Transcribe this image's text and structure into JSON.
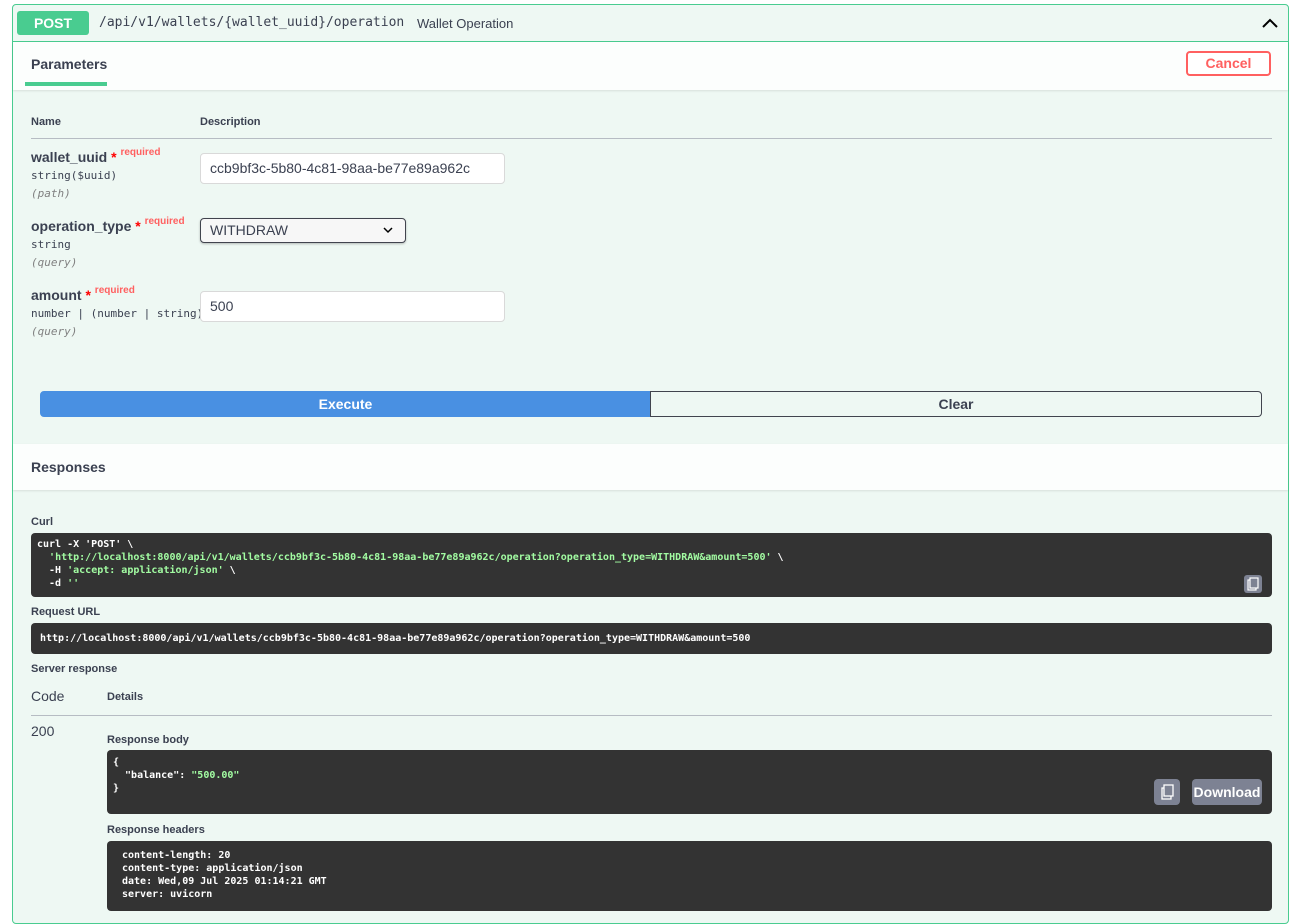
{
  "operation": {
    "method": "POST",
    "path": "/api/v1/wallets/{wallet_uuid}/operation",
    "summary": "Wallet Operation"
  },
  "parameters_tab": "Parameters",
  "cancel_label": "Cancel",
  "table": {
    "name_header": "Name",
    "description_header": "Description"
  },
  "params": [
    {
      "name": "wallet_uuid",
      "star": "*",
      "required": "required",
      "type": "string($uuid)",
      "in": "(path)",
      "value": "ccb9bf3c-5b80-4c81-98aa-be77e89a962c"
    },
    {
      "name": "operation_type",
      "star": "*",
      "required": "required",
      "type": "string",
      "in": "(query)",
      "value": "WITHDRAW"
    },
    {
      "name": "amount",
      "star": "*",
      "required": "required",
      "type": "number | (number | string)",
      "in": "(query)",
      "value": "500"
    }
  ],
  "execute_label": "Execute",
  "clear_label": "Clear",
  "responses_title": "Responses",
  "curl": {
    "label": "Curl",
    "line1": "curl -X 'POST' \\",
    "line2_url": "'http://localhost:8000/api/v1/wallets/ccb9bf3c-5b80-4c81-98aa-be77e89a962c/operation?operation_type=WITHDRAW&amount=500'",
    "line2_tail": " \\",
    "line3_flag": "  -H ",
    "line3_val": "'accept: application/json'",
    "line3_tail": " \\",
    "line4_flag": "  -d ",
    "line4_val": "''"
  },
  "request_url": {
    "label": "Request URL",
    "value": "http://localhost:8000/api/v1/wallets/ccb9bf3c-5b80-4c81-98aa-be77e89a962c/operation?operation_type=WITHDRAW&amount=500"
  },
  "server_response": {
    "label": "Server response",
    "code_header": "Code",
    "details_header": "Details",
    "code": "200",
    "body_label": "Response body",
    "body_open": "{",
    "body_key": "  \"balance\": ",
    "body_value": "\"500.00\"",
    "body_close": "}",
    "download_label": "Download",
    "headers_label": "Response headers",
    "headers": [
      "content-length: 20",
      "content-type: application/json",
      "date: Wed,09 Jul 2025 01:14:21 GMT",
      "server: uvicorn"
    ]
  },
  "colors": {
    "post_green": "#49cc90",
    "execute_blue": "#4990e2",
    "cancel_red": "#ff6060",
    "code_bg": "#333333"
  },
  "icons": [
    "chevron-up-icon",
    "chevron-down-icon",
    "copy-icon"
  ]
}
